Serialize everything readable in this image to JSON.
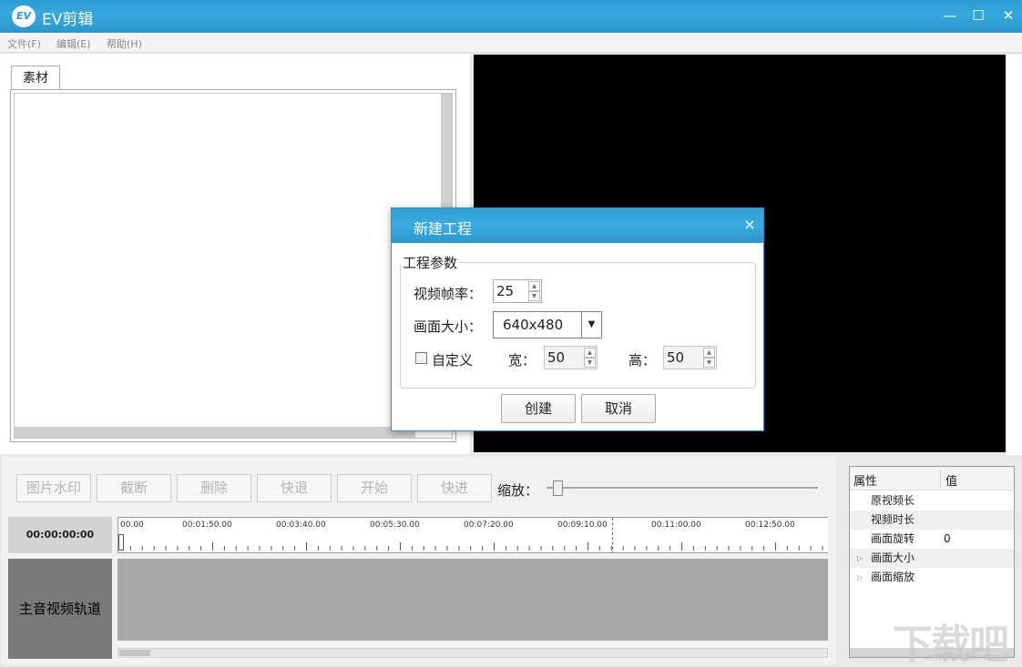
{
  "window": {
    "title": "EV剪辑",
    "logo_text": "EV",
    "minimize_icon": "—",
    "maximize_icon": "☐",
    "close_icon": "✕"
  },
  "menu": [
    {
      "label": "文件(F)"
    },
    {
      "label": "编辑(E)"
    },
    {
      "label": "帮助(H)"
    }
  ],
  "material": {
    "tab_label": "素材"
  },
  "toolbar": {
    "buttons": [
      {
        "label": "图片水印"
      },
      {
        "label": "截断"
      },
      {
        "label": "删除"
      },
      {
        "label": "快退"
      },
      {
        "label": "开始"
      },
      {
        "label": "快进"
      }
    ],
    "zoom_label": "缩放："
  },
  "timeline": {
    "current_time": "00:00:00:00",
    "ruler_labels": [
      "00.00",
      "00:01:50.00",
      "00:03:40.00",
      "00:05:30.00",
      "00:07:20.00",
      "00:09:10.00",
      "00:11:00.00",
      "00:12:50.00"
    ],
    "track_label": "主音视频轨道"
  },
  "properties": {
    "header_name": "属性",
    "header_value": "值",
    "rows": [
      {
        "name": "原视频长",
        "value": ""
      },
      {
        "name": "视频时长",
        "value": ""
      },
      {
        "name": "画面旋转",
        "value": "0"
      },
      {
        "name": "画面大小",
        "value": ""
      },
      {
        "name": "画面缩放",
        "value": ""
      }
    ],
    "expand_icon": "▷"
  },
  "dialog": {
    "title": "新建工程",
    "close_icon": "×",
    "group_title": "工程参数",
    "framerate_label": "视频帧率：",
    "framerate_value": "25",
    "size_label": "画面大小：",
    "size_value": "640x480",
    "size_arrow": "▼",
    "custom_label": "自定义",
    "width_label": "宽：",
    "width_value": "50",
    "height_label": "高：",
    "height_value": "50",
    "spin_up": "▲",
    "spin_down": "▼",
    "create_label": "创建",
    "cancel_label": "取消"
  },
  "watermark": {
    "text": "下载吧",
    "sub": "www.xiazaiba.com"
  }
}
